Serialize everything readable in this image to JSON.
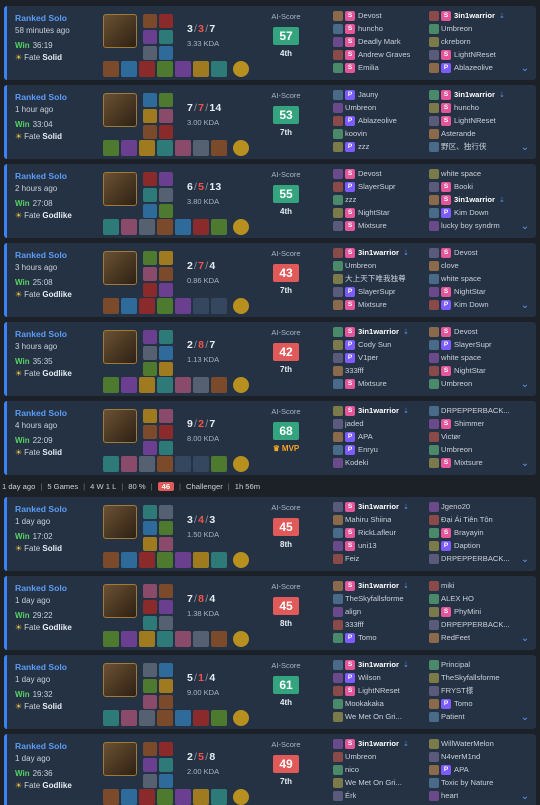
{
  "colors": {
    "accent": "#5b9cf6",
    "win": "#56d364",
    "loss": "#f85149",
    "score_good": "#34a47f",
    "score_bad": "#e05a5a",
    "mvp": "#f5a623"
  },
  "day_summary": {
    "label": "1 day ago",
    "games": "5 Games",
    "record": "4 W 1 L",
    "winrate": "80 %",
    "lp": "46",
    "rank": "Challenger",
    "time": "1h 56m"
  },
  "matches": [
    {
      "queue": "Ranked Solo",
      "ago": "58 minutes ago",
      "result": "Win",
      "duration": "36:19",
      "fate": "Fate",
      "fate_level": "Solid",
      "kills": "3",
      "deaths": "3",
      "assists": "7",
      "kda": "3.33 KDA",
      "score_label": "AI-Score",
      "score": "57",
      "score_tone": "good",
      "rank": "4th",
      "team_a": [
        {
          "name": "Devost",
          "badge": "S",
          "me": false
        },
        {
          "name": "huncho",
          "badge": "S",
          "me": false
        },
        {
          "name": "Deadly Mark",
          "badge": "S",
          "me": false
        },
        {
          "name": "Andrew Graves",
          "badge": "S",
          "me": false
        },
        {
          "name": "Emilia",
          "badge": "S",
          "me": false
        }
      ],
      "team_b": [
        {
          "name": "3in1warrior",
          "badge": "S",
          "me": true
        },
        {
          "name": "Umbreon",
          "badge": "",
          "me": false
        },
        {
          "name": "ckreborn",
          "badge": "",
          "me": false
        },
        {
          "name": "LightNReset",
          "badge": "S",
          "me": false
        },
        {
          "name": "Ablazeolive",
          "badge": "P",
          "me": false
        }
      ]
    },
    {
      "queue": "Ranked Solo",
      "ago": "1 hour ago",
      "result": "Win",
      "duration": "33:04",
      "fate": "Fate",
      "fate_level": "Solid",
      "kills": "7",
      "deaths": "7",
      "assists": "14",
      "kda": "3.00 KDA",
      "score_label": "AI-Score",
      "score": "53",
      "score_tone": "good",
      "rank": "7th",
      "team_a": [
        {
          "name": "Jauny",
          "badge": "P",
          "me": false
        },
        {
          "name": "Umbreon",
          "badge": "",
          "me": false
        },
        {
          "name": "Ablazeolive",
          "badge": "P",
          "me": false
        },
        {
          "name": "koovin",
          "badge": "",
          "me": false
        },
        {
          "name": "zzz",
          "badge": "P",
          "me": false
        }
      ],
      "team_b": [
        {
          "name": "3in1warrior",
          "badge": "S",
          "me": true
        },
        {
          "name": "huncho",
          "badge": "S",
          "me": false
        },
        {
          "name": "LightNReset",
          "badge": "S",
          "me": false
        },
        {
          "name": "Asterande",
          "badge": "",
          "me": false
        },
        {
          "name": "野区、独行侠",
          "badge": "",
          "me": false
        }
      ]
    },
    {
      "queue": "Ranked Solo",
      "ago": "2 hours ago",
      "result": "Win",
      "duration": "27:08",
      "fate": "Fate",
      "fate_level": "Godlike",
      "kills": "6",
      "deaths": "5",
      "assists": "13",
      "kda": "3.80 KDA",
      "score_label": "AI-Score",
      "score": "55",
      "score_tone": "good",
      "rank": "4th",
      "team_a": [
        {
          "name": "Devost",
          "badge": "S",
          "me": false
        },
        {
          "name": "SlayerSupr",
          "badge": "P",
          "me": false
        },
        {
          "name": "zzz",
          "badge": "",
          "me": false
        },
        {
          "name": "NightStar",
          "badge": "S",
          "me": false
        },
        {
          "name": "Mixtsure",
          "badge": "S",
          "me": false
        }
      ],
      "team_b": [
        {
          "name": "white space",
          "badge": "",
          "me": false
        },
        {
          "name": "Booki",
          "badge": "S",
          "me": false
        },
        {
          "name": "3in1warrior",
          "badge": "S",
          "me": true
        },
        {
          "name": "Kim Down",
          "badge": "P",
          "me": false
        },
        {
          "name": "lucky boy syndrm",
          "badge": "",
          "me": false
        }
      ]
    },
    {
      "queue": "Ranked Solo",
      "ago": "3 hours ago",
      "result": "Win",
      "duration": "25:08",
      "fate": "Fate",
      "fate_level": "Godlike",
      "kills": "2",
      "deaths": "7",
      "assists": "4",
      "kda": "0.86 KDA",
      "score_label": "AI-Score",
      "score": "43",
      "score_tone": "bad",
      "rank": "7th",
      "team_a": [
        {
          "name": "3in1warrior",
          "badge": "S",
          "me": true
        },
        {
          "name": "Umbreon",
          "badge": "",
          "me": false
        },
        {
          "name": "大上天下唯我独尊",
          "badge": "",
          "me": false
        },
        {
          "name": "SlayerSupr",
          "badge": "P",
          "me": false
        },
        {
          "name": "Mixtsure",
          "badge": "S",
          "me": false
        }
      ],
      "team_b": [
        {
          "name": "Devost",
          "badge": "S",
          "me": false
        },
        {
          "name": "clove",
          "badge": "",
          "me": false
        },
        {
          "name": "white space",
          "badge": "",
          "me": false
        },
        {
          "name": "NightStar",
          "badge": "S",
          "me": false
        },
        {
          "name": "Kim Down",
          "badge": "P",
          "me": false
        }
      ]
    },
    {
      "queue": "Ranked Solo",
      "ago": "3 hours ago",
      "result": "Win",
      "duration": "35:35",
      "fate": "Fate",
      "fate_level": "Godlike",
      "kills": "2",
      "deaths": "8",
      "assists": "7",
      "kda": "1.13 KDA",
      "score_label": "AI-Score",
      "score": "42",
      "score_tone": "bad",
      "rank": "7th",
      "team_a": [
        {
          "name": "3in1warrior",
          "badge": "S",
          "me": true
        },
        {
          "name": "Cody Sun",
          "badge": "P",
          "me": false
        },
        {
          "name": "V1per",
          "badge": "P",
          "me": false
        },
        {
          "name": "333fff",
          "badge": "",
          "me": false
        },
        {
          "name": "Mixtsure",
          "badge": "S",
          "me": false
        }
      ],
      "team_b": [
        {
          "name": "Devost",
          "badge": "S",
          "me": false
        },
        {
          "name": "SlayerSupr",
          "badge": "P",
          "me": false
        },
        {
          "name": "white space",
          "badge": "",
          "me": false
        },
        {
          "name": "NightStar",
          "badge": "S",
          "me": false
        },
        {
          "name": "Umbreon",
          "badge": "",
          "me": false
        }
      ]
    },
    {
      "queue": "Ranked Solo",
      "ago": "4 hours ago",
      "result": "Win",
      "duration": "22:09",
      "fate": "Fate",
      "fate_level": "Solid",
      "kills": "9",
      "deaths": "2",
      "assists": "7",
      "kda": "8.00 KDA",
      "score_label": "AI-Score",
      "score": "68",
      "score_tone": "good",
      "rank": "MVP",
      "team_a": [
        {
          "name": "3in1warrior",
          "badge": "S",
          "me": true
        },
        {
          "name": "jaded",
          "badge": "",
          "me": false
        },
        {
          "name": "APA",
          "badge": "P",
          "me": false
        },
        {
          "name": "Enryu",
          "badge": "P",
          "me": false
        },
        {
          "name": "Kodeki",
          "badge": "",
          "me": false
        }
      ],
      "team_b": [
        {
          "name": "DRPEPPERBACK...",
          "badge": "",
          "me": false
        },
        {
          "name": "Shimmer",
          "badge": "S",
          "me": false
        },
        {
          "name": "Victør",
          "badge": "",
          "me": false
        },
        {
          "name": "Umbreon",
          "badge": "",
          "me": false
        },
        {
          "name": "Mixtsure",
          "badge": "S",
          "me": false
        }
      ]
    },
    {
      "queue": "Ranked Solo",
      "ago": "1 day ago",
      "result": "Win",
      "duration": "17:02",
      "fate": "Fate",
      "fate_level": "Solid",
      "kills": "3",
      "deaths": "4",
      "assists": "3",
      "kda": "1.50 KDA",
      "score_label": "AI-Score",
      "score": "45",
      "score_tone": "bad",
      "rank": "8th",
      "team_a": [
        {
          "name": "3in1warrior",
          "badge": "S",
          "me": true
        },
        {
          "name": "Mahiru Shiina",
          "badge": "",
          "me": false
        },
        {
          "name": "RickLafleur",
          "badge": "S",
          "me": false
        },
        {
          "name": "uni13",
          "badge": "S",
          "me": false
        },
        {
          "name": "Feiz",
          "badge": "",
          "me": false
        }
      ],
      "team_b": [
        {
          "name": "Jgeno20",
          "badge": "",
          "me": false
        },
        {
          "name": "Đại Ái Tiên Tôn",
          "badge": "",
          "me": false
        },
        {
          "name": "Brayayin",
          "badge": "S",
          "me": false
        },
        {
          "name": "Daption",
          "badge": "P",
          "me": false
        },
        {
          "name": "DRPEPPERBACK...",
          "badge": "",
          "me": false
        }
      ]
    },
    {
      "queue": "Ranked Solo",
      "ago": "1 day ago",
      "result": "Win",
      "duration": "29:22",
      "fate": "Fate",
      "fate_level": "Godlike",
      "kills": "7",
      "deaths": "8",
      "assists": "4",
      "kda": "1.38 KDA",
      "score_label": "AI-Score",
      "score": "45",
      "score_tone": "bad",
      "rank": "8th",
      "team_a": [
        {
          "name": "3in1warrior",
          "badge": "S",
          "me": true
        },
        {
          "name": "TheSkyfallsforme",
          "badge": "",
          "me": false
        },
        {
          "name": "align",
          "badge": "",
          "me": false
        },
        {
          "name": "333fff",
          "badge": "",
          "me": false
        },
        {
          "name": "Tomo",
          "badge": "P",
          "me": false
        }
      ],
      "team_b": [
        {
          "name": "miki",
          "badge": "",
          "me": false
        },
        {
          "name": "ALEX HO",
          "badge": "",
          "me": false
        },
        {
          "name": "PhyMini",
          "badge": "S",
          "me": false
        },
        {
          "name": "DRPEPPERBACK...",
          "badge": "",
          "me": false
        },
        {
          "name": "RedFeet",
          "badge": "",
          "me": false
        }
      ]
    },
    {
      "queue": "Ranked Solo",
      "ago": "1 day ago",
      "result": "Win",
      "duration": "19:32",
      "fate": "Fate",
      "fate_level": "Solid",
      "kills": "5",
      "deaths": "1",
      "assists": "4",
      "kda": "9.00 KDA",
      "score_label": "AI-Score",
      "score": "61",
      "score_tone": "good",
      "rank": "4th",
      "team_a": [
        {
          "name": "3in1warrior",
          "badge": "S",
          "me": true
        },
        {
          "name": "Wilson",
          "badge": "P",
          "me": false
        },
        {
          "name": "LightNReset",
          "badge": "S",
          "me": false
        },
        {
          "name": "Mookakaka",
          "badge": "",
          "me": false
        },
        {
          "name": "We Met On Gri...",
          "badge": "",
          "me": false
        }
      ],
      "team_b": [
        {
          "name": "Principal",
          "badge": "",
          "me": false
        },
        {
          "name": "TheSkyfallsforme",
          "badge": "",
          "me": false
        },
        {
          "name": "FRYST樣",
          "badge": "",
          "me": false
        },
        {
          "name": "Tomo",
          "badge": "P",
          "me": false
        },
        {
          "name": "Patient",
          "badge": "",
          "me": false
        }
      ]
    },
    {
      "queue": "Ranked Solo",
      "ago": "1 day ago",
      "result": "Win",
      "duration": "26:36",
      "fate": "Fate",
      "fate_level": "Godlike",
      "kills": "2",
      "deaths": "5",
      "assists": "8",
      "kda": "2.00 KDA",
      "score_label": "AI-Score",
      "score": "49",
      "score_tone": "bad",
      "rank": "7th",
      "team_a": [
        {
          "name": "3in1warrior",
          "badge": "S",
          "me": true
        },
        {
          "name": "Umbreon",
          "badge": "",
          "me": false
        },
        {
          "name": "nico",
          "badge": "",
          "me": false
        },
        {
          "name": "We Met On Gri...",
          "badge": "",
          "me": false
        },
        {
          "name": "Érk",
          "badge": "",
          "me": false
        }
      ],
      "team_b": [
        {
          "name": "WillWaterMelon",
          "badge": "",
          "me": false
        },
        {
          "name": "N4verM1nd",
          "badge": "",
          "me": false
        },
        {
          "name": "APA",
          "badge": "P",
          "me": false
        },
        {
          "name": "Toxic by Nature",
          "badge": "",
          "me": false
        },
        {
          "name": "heart",
          "badge": "",
          "me": false
        }
      ]
    }
  ]
}
